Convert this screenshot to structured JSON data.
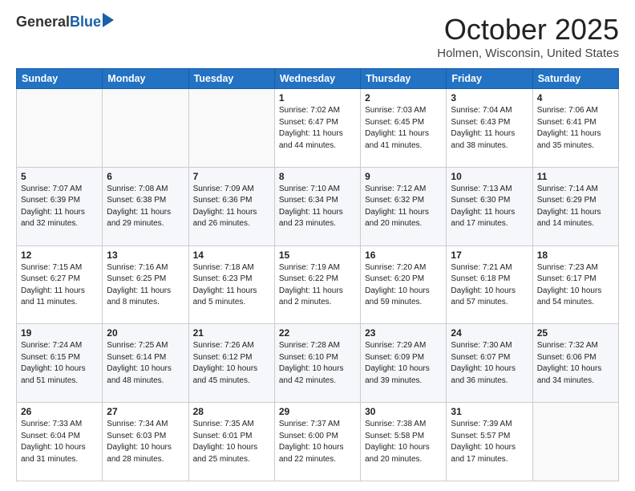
{
  "logo": {
    "general": "General",
    "blue": "Blue"
  },
  "title": "October 2025",
  "location": "Holmen, Wisconsin, United States",
  "days_header": [
    "Sunday",
    "Monday",
    "Tuesday",
    "Wednesday",
    "Thursday",
    "Friday",
    "Saturday"
  ],
  "weeks": [
    [
      {
        "day": "",
        "info": ""
      },
      {
        "day": "",
        "info": ""
      },
      {
        "day": "",
        "info": ""
      },
      {
        "day": "1",
        "info": "Sunrise: 7:02 AM\nSunset: 6:47 PM\nDaylight: 11 hours\nand 44 minutes."
      },
      {
        "day": "2",
        "info": "Sunrise: 7:03 AM\nSunset: 6:45 PM\nDaylight: 11 hours\nand 41 minutes."
      },
      {
        "day": "3",
        "info": "Sunrise: 7:04 AM\nSunset: 6:43 PM\nDaylight: 11 hours\nand 38 minutes."
      },
      {
        "day": "4",
        "info": "Sunrise: 7:06 AM\nSunset: 6:41 PM\nDaylight: 11 hours\nand 35 minutes."
      }
    ],
    [
      {
        "day": "5",
        "info": "Sunrise: 7:07 AM\nSunset: 6:39 PM\nDaylight: 11 hours\nand 32 minutes."
      },
      {
        "day": "6",
        "info": "Sunrise: 7:08 AM\nSunset: 6:38 PM\nDaylight: 11 hours\nand 29 minutes."
      },
      {
        "day": "7",
        "info": "Sunrise: 7:09 AM\nSunset: 6:36 PM\nDaylight: 11 hours\nand 26 minutes."
      },
      {
        "day": "8",
        "info": "Sunrise: 7:10 AM\nSunset: 6:34 PM\nDaylight: 11 hours\nand 23 minutes."
      },
      {
        "day": "9",
        "info": "Sunrise: 7:12 AM\nSunset: 6:32 PM\nDaylight: 11 hours\nand 20 minutes."
      },
      {
        "day": "10",
        "info": "Sunrise: 7:13 AM\nSunset: 6:30 PM\nDaylight: 11 hours\nand 17 minutes."
      },
      {
        "day": "11",
        "info": "Sunrise: 7:14 AM\nSunset: 6:29 PM\nDaylight: 11 hours\nand 14 minutes."
      }
    ],
    [
      {
        "day": "12",
        "info": "Sunrise: 7:15 AM\nSunset: 6:27 PM\nDaylight: 11 hours\nand 11 minutes."
      },
      {
        "day": "13",
        "info": "Sunrise: 7:16 AM\nSunset: 6:25 PM\nDaylight: 11 hours\nand 8 minutes."
      },
      {
        "day": "14",
        "info": "Sunrise: 7:18 AM\nSunset: 6:23 PM\nDaylight: 11 hours\nand 5 minutes."
      },
      {
        "day": "15",
        "info": "Sunrise: 7:19 AM\nSunset: 6:22 PM\nDaylight: 11 hours\nand 2 minutes."
      },
      {
        "day": "16",
        "info": "Sunrise: 7:20 AM\nSunset: 6:20 PM\nDaylight: 10 hours\nand 59 minutes."
      },
      {
        "day": "17",
        "info": "Sunrise: 7:21 AM\nSunset: 6:18 PM\nDaylight: 10 hours\nand 57 minutes."
      },
      {
        "day": "18",
        "info": "Sunrise: 7:23 AM\nSunset: 6:17 PM\nDaylight: 10 hours\nand 54 minutes."
      }
    ],
    [
      {
        "day": "19",
        "info": "Sunrise: 7:24 AM\nSunset: 6:15 PM\nDaylight: 10 hours\nand 51 minutes."
      },
      {
        "day": "20",
        "info": "Sunrise: 7:25 AM\nSunset: 6:14 PM\nDaylight: 10 hours\nand 48 minutes."
      },
      {
        "day": "21",
        "info": "Sunrise: 7:26 AM\nSunset: 6:12 PM\nDaylight: 10 hours\nand 45 minutes."
      },
      {
        "day": "22",
        "info": "Sunrise: 7:28 AM\nSunset: 6:10 PM\nDaylight: 10 hours\nand 42 minutes."
      },
      {
        "day": "23",
        "info": "Sunrise: 7:29 AM\nSunset: 6:09 PM\nDaylight: 10 hours\nand 39 minutes."
      },
      {
        "day": "24",
        "info": "Sunrise: 7:30 AM\nSunset: 6:07 PM\nDaylight: 10 hours\nand 36 minutes."
      },
      {
        "day": "25",
        "info": "Sunrise: 7:32 AM\nSunset: 6:06 PM\nDaylight: 10 hours\nand 34 minutes."
      }
    ],
    [
      {
        "day": "26",
        "info": "Sunrise: 7:33 AM\nSunset: 6:04 PM\nDaylight: 10 hours\nand 31 minutes."
      },
      {
        "day": "27",
        "info": "Sunrise: 7:34 AM\nSunset: 6:03 PM\nDaylight: 10 hours\nand 28 minutes."
      },
      {
        "day": "28",
        "info": "Sunrise: 7:35 AM\nSunset: 6:01 PM\nDaylight: 10 hours\nand 25 minutes."
      },
      {
        "day": "29",
        "info": "Sunrise: 7:37 AM\nSunset: 6:00 PM\nDaylight: 10 hours\nand 22 minutes."
      },
      {
        "day": "30",
        "info": "Sunrise: 7:38 AM\nSunset: 5:58 PM\nDaylight: 10 hours\nand 20 minutes."
      },
      {
        "day": "31",
        "info": "Sunrise: 7:39 AM\nSunset: 5:57 PM\nDaylight: 10 hours\nand 17 minutes."
      },
      {
        "day": "",
        "info": ""
      }
    ]
  ]
}
